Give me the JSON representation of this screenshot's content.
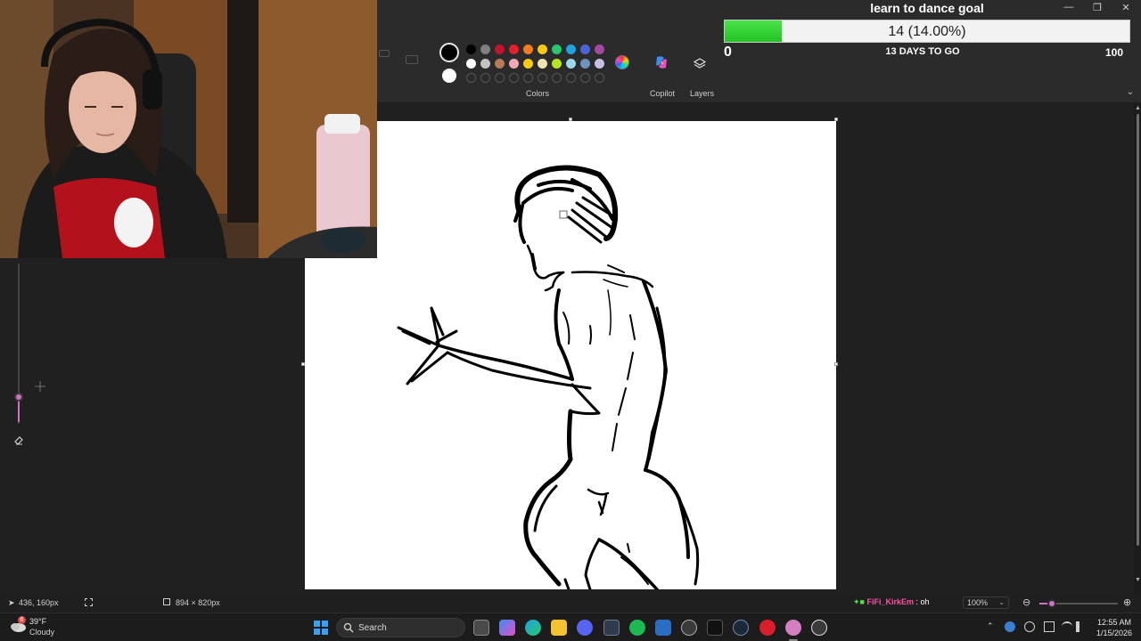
{
  "ribbon": {
    "colors_label": "Colors",
    "copilot_label": "Copilot",
    "layers_label": "Layers",
    "palette": {
      "row1": [
        "#000000",
        "#7f7f7f",
        "#c3132f",
        "#e4202c",
        "#f47b20",
        "#f9c80e",
        "#28c76f",
        "#1fa2e0",
        "#4b63d8",
        "#a349a4"
      ],
      "row2": [
        "#ffffff",
        "#c3c3c3",
        "#b97a57",
        "#f2a7b5",
        "#ffc90e",
        "#efe4b0",
        "#b5e61d",
        "#99d9ea",
        "#7092be",
        "#c8bfe7"
      ]
    },
    "primary_color": "#000000",
    "secondary_color": "#ffffff"
  },
  "goal": {
    "title": "learn to dance goal",
    "progress_text": "14 (14.00%)",
    "progress_percent": 14,
    "min_label": "0",
    "days_left": "13 DAYS TO GO",
    "max_label": "100"
  },
  "status": {
    "cursor_pos": "436, 160px",
    "canvas_size": "894 × 820px",
    "chat_user": "FiFi_KirkEm",
    "chat_message": ": oh",
    "zoom": "100%",
    "brush_size_percent": 18
  },
  "taskbar": {
    "weather_badge": "6",
    "weather_temp": "39°F",
    "weather_condition": "Cloudy",
    "search_placeholder": "Search",
    "clock_time": "12:55 AM",
    "clock_date": "1/15/2026"
  }
}
